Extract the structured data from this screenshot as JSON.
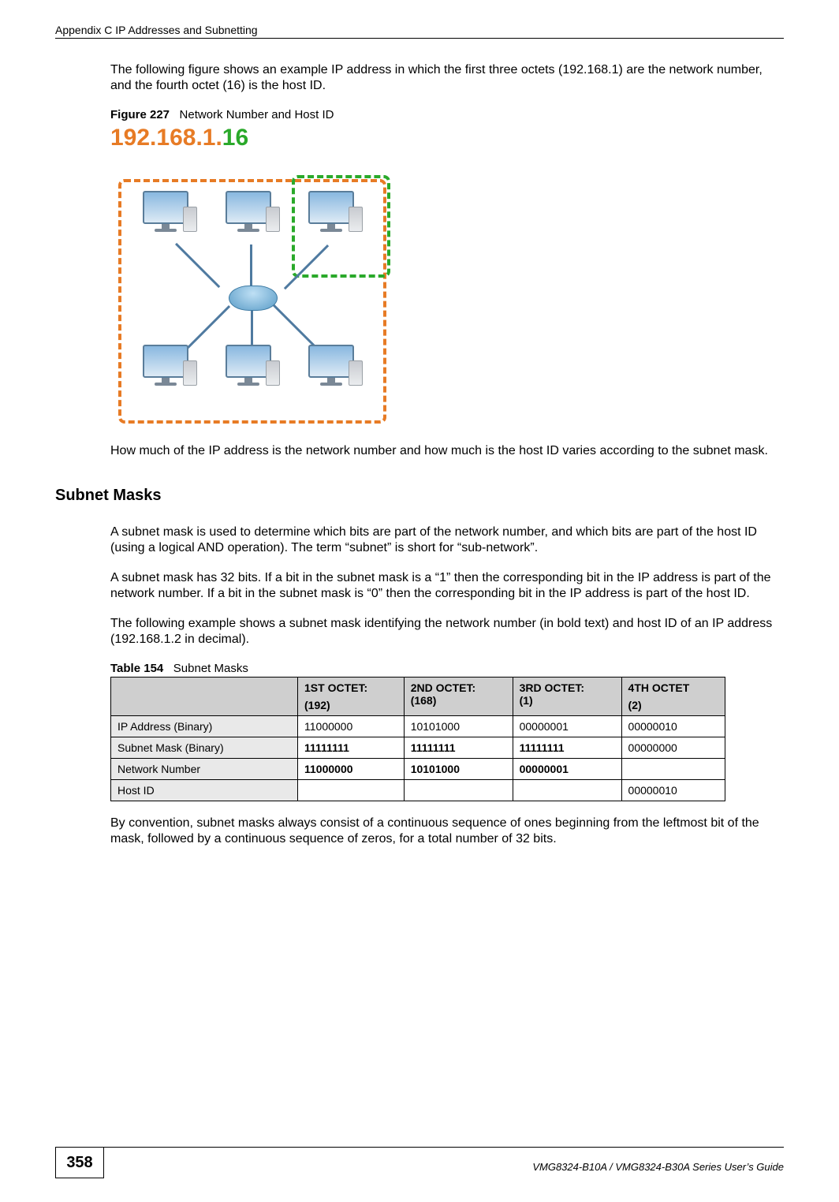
{
  "header": {
    "left": "Appendix C IP Addresses and Subnetting"
  },
  "intro_para": "The following figure shows an example IP address in which the first three octets (192.168.1) are the network number, and the fourth octet (16) is the host ID.",
  "figure227": {
    "label": "Figure 227",
    "title": "Network Number and Host ID",
    "ip_example_network": "192.168.1.",
    "ip_example_host": "16"
  },
  "after_fig_para": "How much of the IP address is the network number and how much is the host ID varies according to the subnet mask.",
  "section_title": "Subnet Masks",
  "para_sub1": "A subnet mask is used to determine which bits are part of the network number, and which bits are part of the host ID (using a logical AND operation). The term “subnet” is short for “sub-network”.",
  "para_sub2": "A subnet mask has 32 bits. If a bit in the subnet mask is a “1” then the corresponding bit in the IP address is part of the network number. If a bit in the subnet mask is “0” then the corresponding bit in the IP address is part of the host ID.",
  "para_sub3": "The following example shows a subnet mask identifying the network number (in bold text) and host ID of an IP address (192.168.1.2 in decimal).",
  "table154": {
    "label": "Table 154",
    "title": "Subnet Masks",
    "headers": {
      "c0": "",
      "c1_top": "1ST OCTET:",
      "c1_bottom": "(192)",
      "c2_top": "2ND OCTET:",
      "c2_bottom": "(168)",
      "c3_top": "3RD OCTET:",
      "c3_bottom": "(1)",
      "c4_top": "4TH OCTET",
      "c4_bottom": "(2)"
    },
    "rows": [
      {
        "label": "IP Address (Binary)",
        "o1": "11000000",
        "o2": "10101000",
        "o3": "00000001",
        "o4": "00000010",
        "bold": [
          false,
          false,
          false,
          false
        ]
      },
      {
        "label": "Subnet Mask (Binary)",
        "o1": "11111111",
        "o2": "11111111",
        "o3": "11111111",
        "o4": "00000000",
        "bold": [
          true,
          true,
          true,
          false
        ]
      },
      {
        "label": "Network Number",
        "o1": "11000000",
        "o2": "10101000",
        "o3": "00000001",
        "o4": "",
        "bold": [
          true,
          true,
          true,
          false
        ]
      },
      {
        "label": "Host ID",
        "o1": "",
        "o2": "",
        "o3": "",
        "o4": "00000010",
        "bold": [
          false,
          false,
          false,
          false
        ]
      }
    ]
  },
  "closing_para": "By convention, subnet masks always consist of a continuous sequence of ones beginning from the leftmost bit of the mask, followed by a continuous sequence of zeros, for a total number of 32 bits.",
  "footer": {
    "page_number": "358",
    "right_text": "VMG8324-B10A / VMG8324-B30A Series User’s Guide"
  }
}
